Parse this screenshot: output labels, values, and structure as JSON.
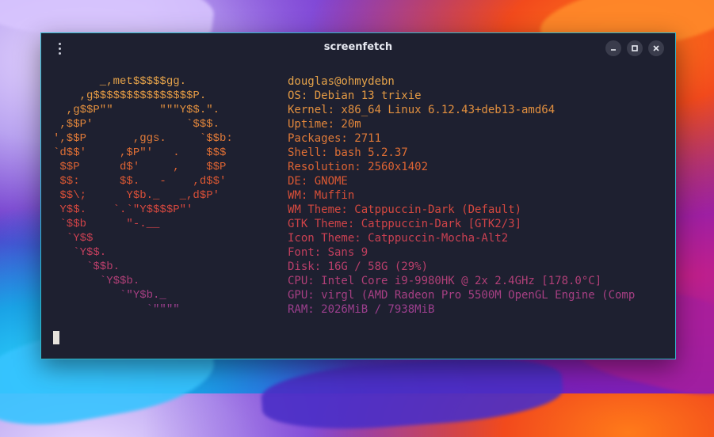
{
  "window": {
    "title": "screenfetch",
    "border_color": "#2fb8c9",
    "background": "#1e2030"
  },
  "icons": {
    "menu": "kebab-menu-icon",
    "minimize": "minimize-icon",
    "maximize": "maximize-icon",
    "close": "close-icon"
  },
  "ascii_art": [
    {
      "text": "       _,met$$$$$gg.",
      "color": "#e4a24a"
    },
    {
      "text": "    ,g$$$$$$$$$$$$$$$P.",
      "color": "#e49a44"
    },
    {
      "text": "  ,g$$P\"\"       \"\"\"Y$$.\".",
      "color": "#e3903f"
    },
    {
      "text": " ,$$P'              `$$$.",
      "color": "#e2863b"
    },
    {
      "text": "',$$P       ,ggs.     `$$b:",
      "color": "#e07a38"
    },
    {
      "text": "`d$$'     ,$P\"'   .    $$$",
      "color": "#df6f35"
    },
    {
      "text": " $$P      d$'     ,    $$P",
      "color": "#dd6333"
    },
    {
      "text": " $$:      $$.   -    ,d$$'",
      "color": "#db5833"
    },
    {
      "text": " $$\\;      Y$b._   _,d$P'",
      "color": "#d84f38"
    },
    {
      "text": " Y$$.    `.`\"Y$$$$P\"'",
      "color": "#d4483f"
    },
    {
      "text": " `$$b      \"-.__",
      "color": "#cf4348"
    },
    {
      "text": "  `Y$$",
      "color": "#c94052"
    },
    {
      "text": "   `Y$$.",
      "color": "#c23f5e"
    },
    {
      "text": "     `$$b.",
      "color": "#b93f6b"
    },
    {
      "text": "       `Y$$b.",
      "color": "#b03f77"
    },
    {
      "text": "          `\"Y$b._",
      "color": "#a63f83"
    },
    {
      "text": "              `\"\"\"\"",
      "color": "#9c3f8e"
    }
  ],
  "info_lines": [
    {
      "text": "douglas@ohmydebn",
      "color": "#e4a24a"
    },
    {
      "text": "OS: Debian 13 trixie",
      "color": "#e49a44"
    },
    {
      "text": "Kernel: x86_64 Linux 6.12.43+deb13-amd64",
      "color": "#e3903f"
    },
    {
      "text": "Uptime: 20m",
      "color": "#e2863b"
    },
    {
      "text": "Packages: 2711",
      "color": "#e07a38"
    },
    {
      "text": "Shell: bash 5.2.37",
      "color": "#df6f35"
    },
    {
      "text": "Resolution: 2560x1402",
      "color": "#dd6333"
    },
    {
      "text": "DE: GNOME",
      "color": "#db5833"
    },
    {
      "text": "WM: Muffin",
      "color": "#d84f38"
    },
    {
      "text": "WM Theme: Catppuccin-Dark (Default)",
      "color": "#d4483f"
    },
    {
      "text": "GTK Theme: Catppuccin-Dark [GTK2/3]",
      "color": "#cf4348"
    },
    {
      "text": "Icon Theme: Catppuccin-Mocha-Alt2",
      "color": "#c94052"
    },
    {
      "text": "Font: Sans 9",
      "color": "#c23f5e"
    },
    {
      "text": "Disk: 16G / 58G (29%)",
      "color": "#b93f6b"
    },
    {
      "text": "CPU: Intel Core i9-9980HK @ 2x 2.4GHz [178.0°C]",
      "color": "#b03f77"
    },
    {
      "text": "GPU: virgl (AMD Radeon Pro 5500M OpenGL Engine (Comp",
      "color": "#a63f83"
    },
    {
      "text": "RAM: 2026MiB / 7938MiB",
      "color": "#9c3f8e"
    }
  ]
}
